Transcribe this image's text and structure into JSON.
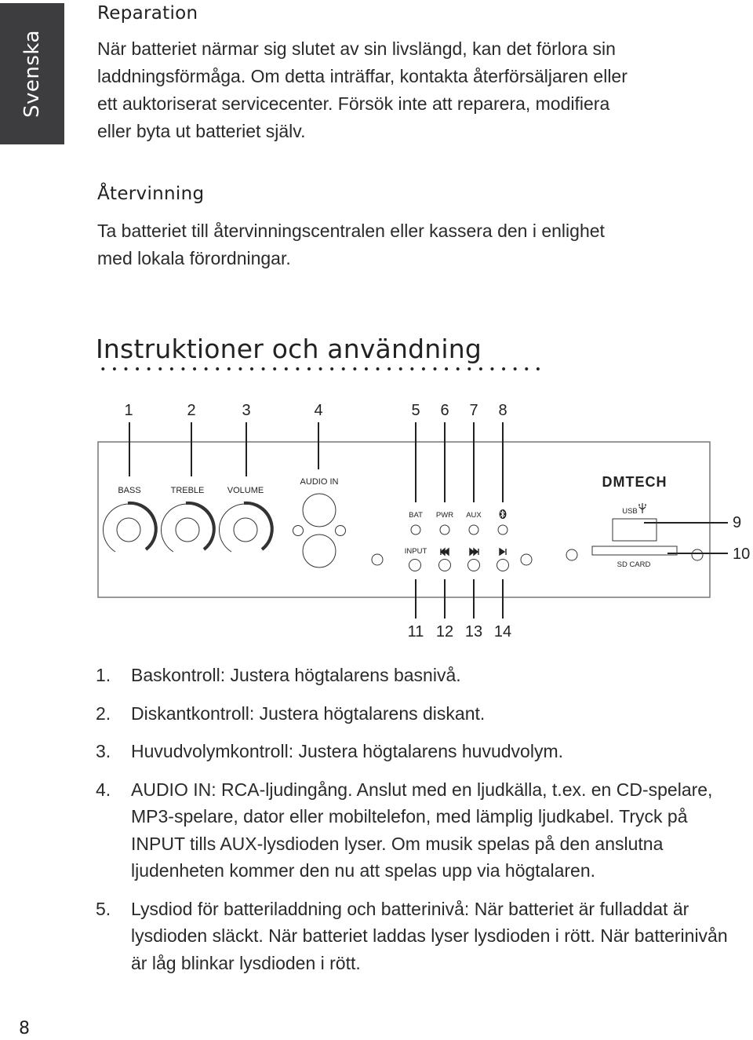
{
  "side_tab": {
    "label": "Svenska"
  },
  "page_number": "8",
  "sections": [
    {
      "heading": "Reparation",
      "lines": [
        "När batteriet närmar sig slutet av sin livslängd, kan det förlora sin",
        "laddningsförmåga. Om detta inträffar, kontakta återförsäljaren eller",
        "ett auktoriserat servicecenter. Försök inte att reparera, modifiera",
        "eller byta ut batteriet själv."
      ]
    },
    {
      "heading": "Återvinning",
      "lines": [
        "Ta batteriet till återvinningscentralen eller kassera den i enlighet",
        "med lokala förordningar."
      ]
    }
  ],
  "main_heading": "Instruktioner och användning",
  "diagram": {
    "callouts_top": [
      "1",
      "2",
      "3",
      "4",
      "5",
      "6",
      "7",
      "8"
    ],
    "callouts_bottom": [
      "11",
      "12",
      "13",
      "14"
    ],
    "callouts_right": [
      "9",
      "10"
    ],
    "knob_labels": [
      "BASS",
      "TREBLE",
      "VOLUME"
    ],
    "audio_in_label": "AUDIO IN",
    "led_labels": [
      "BAT",
      "PWR",
      "AUX"
    ],
    "button_labels": [
      "INPUT"
    ],
    "brand": "DMTECH",
    "usb_label": "USB",
    "sd_label": "SD CARD"
  },
  "items": [
    {
      "num": "1.",
      "text": "Baskontroll: Justera högtalarens basnivå."
    },
    {
      "num": "2.",
      "text": "Diskantkontroll: Justera högtalarens diskant."
    },
    {
      "num": "3.",
      "text": "Huvudvolymkontroll: Justera högtalarens huvudvolym."
    },
    {
      "num": "4.",
      "text": "AUDIO IN: RCA-ljudingång. Anslut med en ljudkälla, t.ex. en CD-spelare, MP3-spelare, dator eller mobiltelefon, med lämplig ljudkabel. Tryck på INPUT tills AUX-lysdioden lyser. Om musik spelas på den anslutna ljudenheten kommer den nu att spelas upp via högtalaren."
    },
    {
      "num": "5.",
      "text": "Lysdiod för batteriladdning och batterinivå: När batteriet är fulladdat är lysdioden släckt. När batteriet laddas lyser lysdioden i rött. När batterinivån är låg blinkar lysdioden i rött."
    }
  ]
}
